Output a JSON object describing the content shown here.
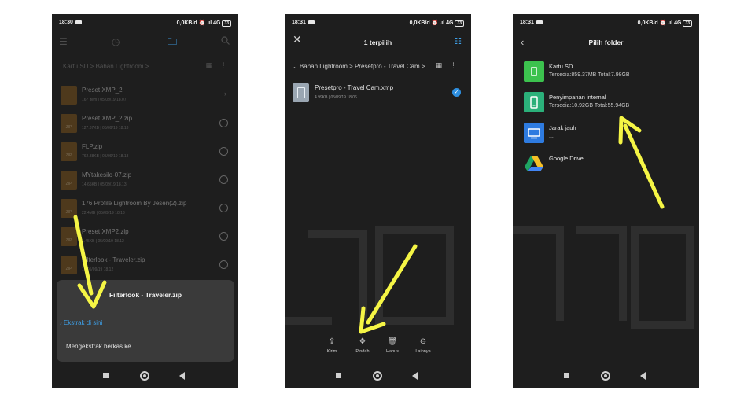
{
  "colors": {
    "arrow": "#f5f545",
    "accent": "#2e8fe0",
    "phone_bg": "#1e1e1e",
    "folder": "#8a5a1a"
  },
  "phone1": {
    "status": {
      "time": "18:30",
      "right": "0,0KB/d ⏰ .ıl 4G",
      "battery": "33"
    },
    "breadcrumb": "Kartu SD > Bahan Lightroom >",
    "files": [
      {
        "name": "Preset XMP_2",
        "meta": "167 item  |  05/09/19 18.07",
        "thumb": "",
        "kind": "folder"
      },
      {
        "name": "Preset XMP_2.zip",
        "meta": "127.67KB  |  05/09/19 18.13",
        "thumb": "ZIP",
        "kind": "zip"
      },
      {
        "name": "FLP.zip",
        "meta": "762.88KB  |  05/09/19 18.13",
        "thumb": "ZIP",
        "kind": "zip"
      },
      {
        "name": "MYtakesilo-07.zip",
        "meta": "14.65KB  |  05/09/19 18.13",
        "thumb": "ZIP",
        "kind": "zip"
      },
      {
        "name": "176 Profile Lightroom By Jesen(2).zip",
        "meta": "22.4MB  |  05/09/19 18.13",
        "thumb": "ZIP",
        "kind": "zip"
      },
      {
        "name": "Preset XMP2.zip",
        "meta": "1.45KB  |  05/09/19 18.12",
        "thumb": "ZIP",
        "kind": "zip"
      },
      {
        "name": "Filterlook - Traveler.zip",
        "meta": "1  |  05/09/19 18.12",
        "thumb": "ZIP",
        "kind": "zip"
      }
    ],
    "sheet": {
      "title": "Filterlook - Traveler.zip",
      "link": "› Ekstrak di sini",
      "status": "Mengekstrak berkas ke..."
    }
  },
  "phone2": {
    "status": {
      "time": "18:31",
      "right": "0,0KB/d ⏰ .ıl 4G",
      "battery": "33"
    },
    "title": "1  terpilih",
    "breadcrumb": "⌄   Bahan Lightroom > Presetpro - Travel Cam >",
    "file": {
      "name": "Presetpro - Travel Cam.xmp",
      "meta": "4.99KB  |  05/09/19 18.06"
    },
    "actions": [
      {
        "label": "Kirim",
        "icon": "share-icon"
      },
      {
        "label": "Pindah",
        "icon": "move-icon"
      },
      {
        "label": "Hapus",
        "icon": "trash-icon"
      },
      {
        "label": "Lainnya",
        "icon": "more-icon"
      }
    ]
  },
  "phone3": {
    "status": {
      "time": "18:31",
      "right": "0,0KB/d ⏰ .ıl 4G",
      "battery": "33"
    },
    "title": "Pilih folder",
    "locations": [
      {
        "name": "Kartu SD",
        "info": "Tersedia:859.37MB Total:7.98GB",
        "color": "#3cc24e",
        "icon": "sd-card-icon"
      },
      {
        "name": "Penyimpanan internal",
        "info": "Tersedia:10.92GB Total:55.94GB",
        "color": "#2bb07a",
        "icon": "phone-storage-icon"
      },
      {
        "name": "Jarak jauh",
        "info": "...",
        "color": "#2e7be0",
        "icon": "remote-icon"
      },
      {
        "name": "Google Drive",
        "info": "...",
        "color": "",
        "icon": "google-drive-icon"
      }
    ]
  }
}
